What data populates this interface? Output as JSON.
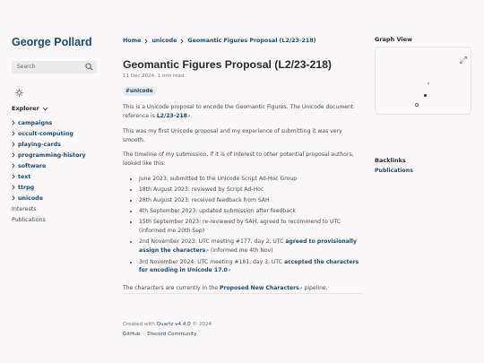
{
  "site": {
    "title": "George Pollard"
  },
  "search": {
    "placeholder": "Search"
  },
  "explorer": {
    "heading": "Explorer",
    "folders": [
      "campaigns",
      "occult-computing",
      "playing-cards",
      "programming-history",
      "software",
      "text",
      "ttrpg",
      "unicode"
    ],
    "files": [
      "Interests",
      "Publications"
    ]
  },
  "breadcrumbs": [
    "Home",
    "unicode",
    "Geomantic Figures Proposal (L2/23-218)"
  ],
  "article": {
    "title": "Geomantic Figures Proposal (L2/23-218)",
    "date": "11 Dec 2024",
    "read_time": "1 min read",
    "tag": "#unicode",
    "intro": "This is a Unicode proposal to encode the Geomantic Figures. The Unicode document reference is",
    "doc_ref": "L2/23-218",
    "p2": "This was my first Unicode proposal and my experience of submitting it was very smooth.",
    "p3": "The timeline of my submission, if it is of interest to other potential proposal authors, looked like this:",
    "timeline": {
      "t1": "June 2023: submitted to the Unicode Script Ad-Hoc Group",
      "t2": "18th August 2023: reviewed by Script Ad-Hoc",
      "t3": "28th August 2023: received feedback from SAH",
      "t4": "4th September 2023: updated submission after feedback",
      "t5": "15th September 2023: re-reviewed by SAH, agreed to recommend to UTC (informed me 20th Sep)",
      "t6_pre": "2nd November 2023: UTC meeting #177, day 2, UTC",
      "t6_link": "agreed to provisionally assign the characters",
      "t6_post": "(informed me 4th Nov)",
      "t7_pre": "3rd November 2024: UTC meeting #181, day 3, UTC",
      "t7_link": "accepted the characters for encoding in Unicode 17.0"
    },
    "closing_pre": "The characters are currently in the",
    "closing_link": "Proposed New Characters",
    "closing_post": "pipeline."
  },
  "footer": {
    "created_pre": "Created with",
    "quartz": "Quartz v4.4.0",
    "year": "© 2024",
    "github": "GitHub",
    "discord": "Discord Community"
  },
  "right": {
    "graph_heading": "Graph View",
    "backlinks_heading": "Backlinks",
    "backlinks": [
      "Publications"
    ]
  },
  "colors": {
    "accent": "#284b63",
    "text": "#4e4e4e",
    "background": "#faf8f8"
  }
}
